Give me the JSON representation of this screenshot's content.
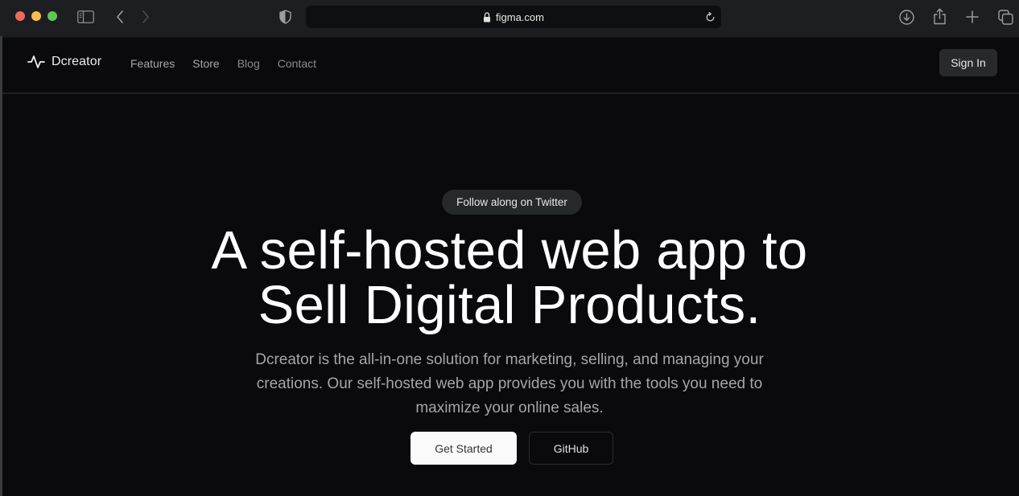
{
  "browser": {
    "url": "figma.com",
    "icons": {
      "close": "traffic-light-close",
      "minimize": "traffic-light-minimize",
      "maximize": "traffic-light-maximize",
      "sidebar": "sidebar-icon",
      "back": "chevron-left-icon",
      "forward": "chevron-right-icon",
      "privacy": "shield-icon",
      "lock": "lock-icon",
      "reload": "reload-icon",
      "downloads": "download-icon",
      "share": "share-icon",
      "new_tab": "plus-icon",
      "tabs": "tabs-overview-icon"
    }
  },
  "nav": {
    "brand": "Dcreator",
    "brand_icon": "activity-pulse-icon",
    "links": [
      {
        "label": "Features"
      },
      {
        "label": "Store"
      },
      {
        "label": "Blog"
      },
      {
        "label": "Contact"
      }
    ],
    "signin_label": "Sign In"
  },
  "hero": {
    "pill_label": "Follow along on Twitter",
    "headline_line1": "A self-hosted web app to",
    "headline_line2": "Sell Digital Products.",
    "subtext": "Dcreator is the all-in-one solution for marketing, selling, and managing your creations. Our self-hosted web app provides you with the tools you need to maximize your online sales.",
    "primary_cta": "Get Started",
    "secondary_cta": "GitHub"
  },
  "colors": {
    "background": "#0a0a0c",
    "chrome": "#1c1e21",
    "pill": "#27282b",
    "primary_button": "#fafafa"
  }
}
